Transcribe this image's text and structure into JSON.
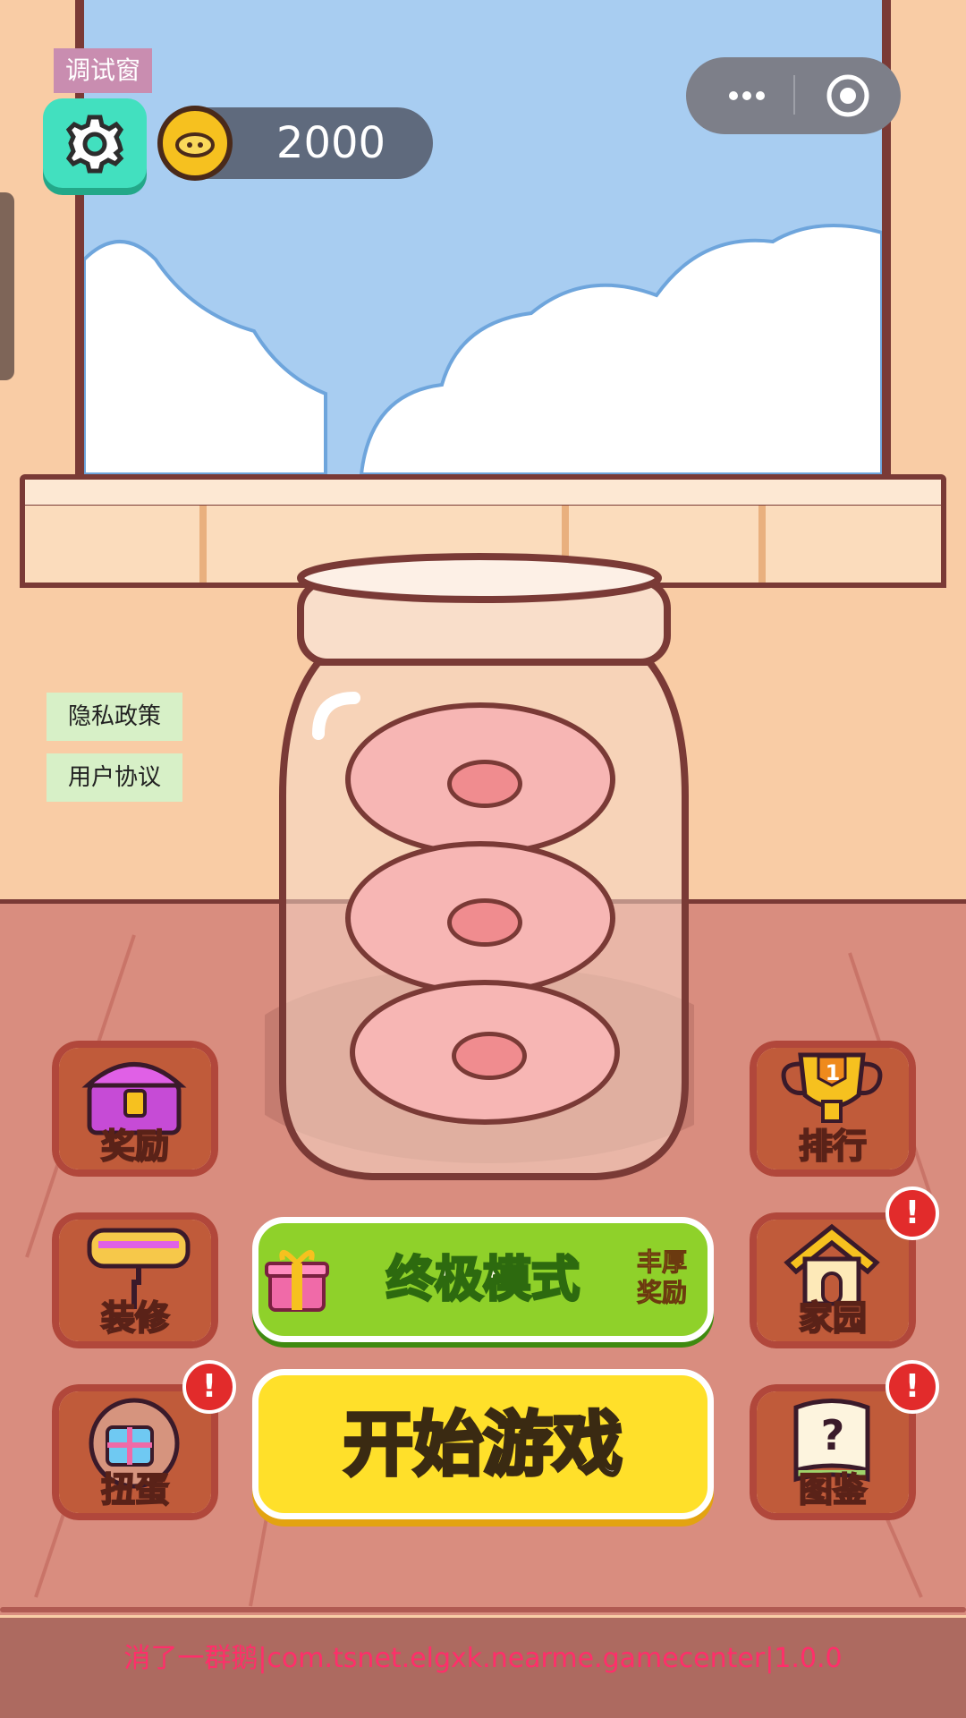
{
  "debug_tab": "调试窗",
  "coins": "2000",
  "links": {
    "privacy": "隐私政策",
    "agreement": "用户协议"
  },
  "menu": {
    "rewards": "奖励",
    "ranking": "排行",
    "rank_number": "1",
    "decorate": "装修",
    "home": "家园",
    "gacha": "扭蛋",
    "collection": "图鉴",
    "collection_mark": "?"
  },
  "badge_mark": "!",
  "ultimate": {
    "label": "终极模式",
    "sub_line1": "丰厚",
    "sub_line2": "奖励"
  },
  "start_label": "开始游戏",
  "footer": "消了一群鹅|com.tsnet.elgxk.nearme.gamecenter|1.0.0",
  "colors": {
    "sky": "#a8cdf1",
    "wall": "#f9cca5",
    "floor": "#d98d7f",
    "start_button": "#ffe02a",
    "ultimate_button": "#8fd12a",
    "accent_teal": "#42e0bf"
  }
}
